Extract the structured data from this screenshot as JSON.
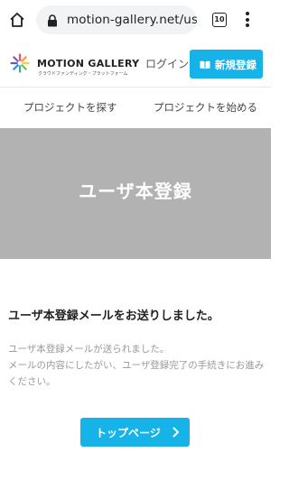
{
  "browser": {
    "url": "motion-gallery.net/user",
    "tab_count": "10"
  },
  "header": {
    "logo_text": "MOTION GALLERY",
    "logo_subtitle": "クラウドファンディング・プラットフォーム",
    "login_label": "ログイン",
    "register_label": "新規登録"
  },
  "nav": {
    "items": [
      "プロジェクトを探す",
      "プロジェクトを始める"
    ]
  },
  "hero": {
    "title": "ユーザ本登録"
  },
  "content": {
    "heading": "ユーザ本登録メールをお送りしました。",
    "line1": "ユーザ本登録メールが送られました。",
    "line2": "メールの内容にしたがい、ユーザ登録完了の手続きにお進みください。"
  },
  "button": {
    "top_page_label": "トップページ"
  },
  "colors": {
    "accent": "#15b3e8",
    "hero_bg": "#b2b2b2"
  },
  "icons": [
    "home-icon",
    "lock-icon",
    "tabs-icon",
    "more-vert-icon",
    "book-icon",
    "chevron-right-icon"
  ]
}
